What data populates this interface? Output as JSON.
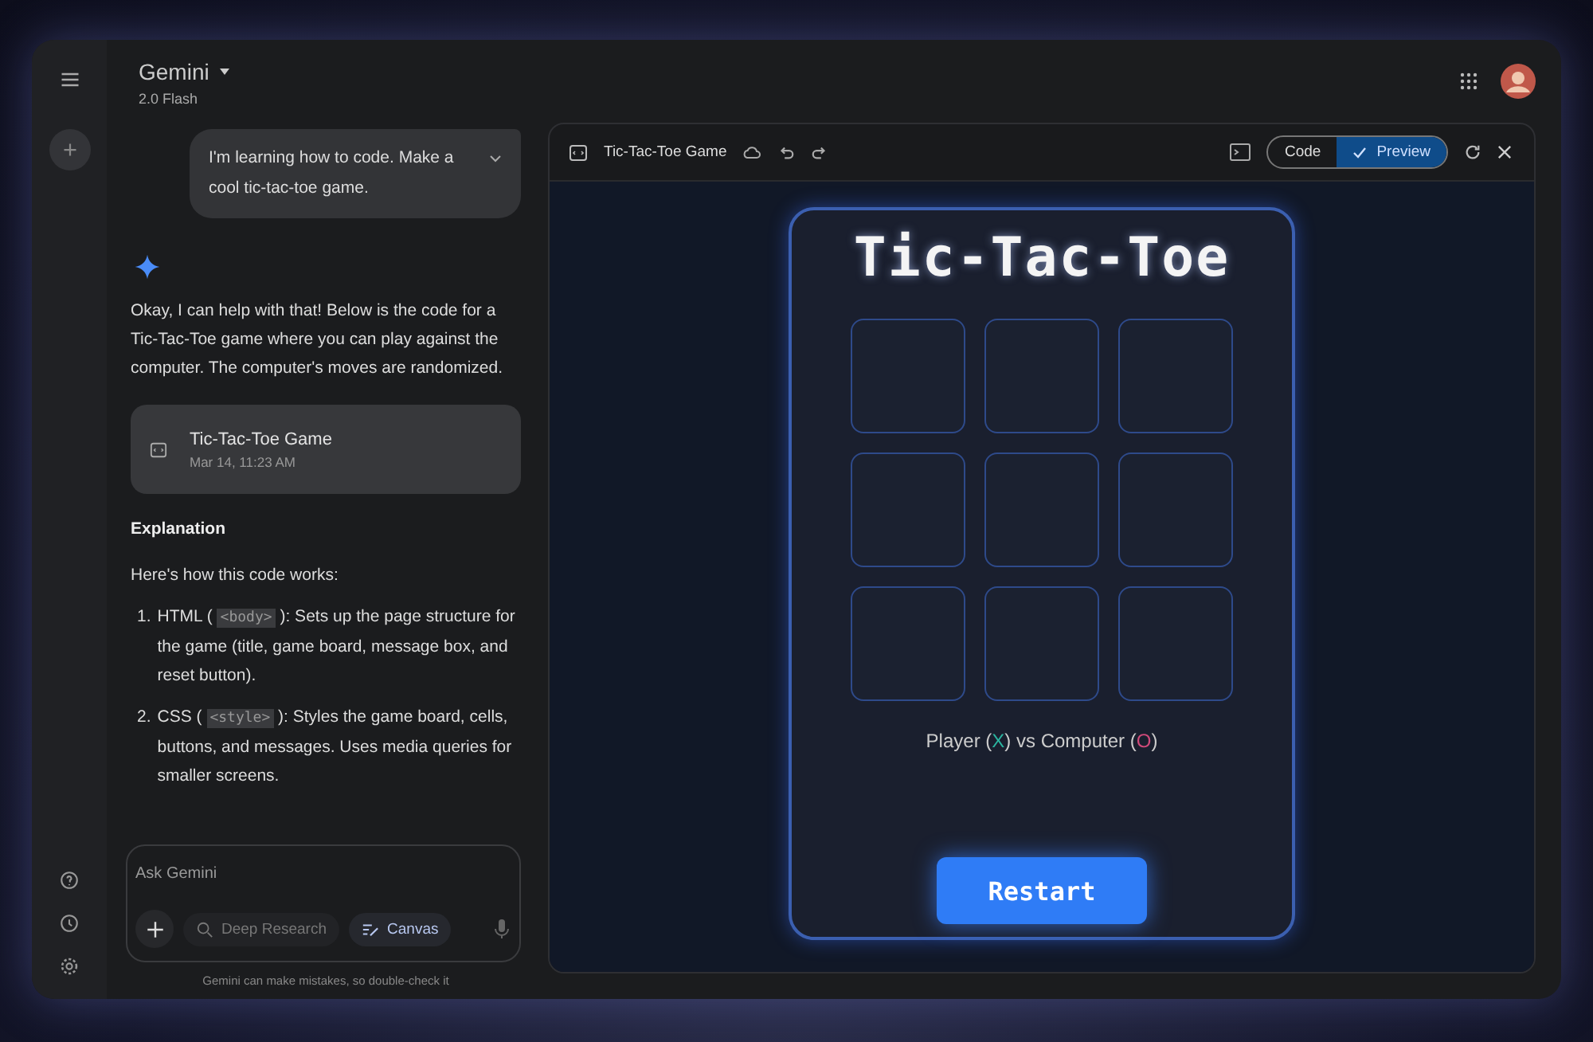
{
  "header": {
    "title": "Gemini",
    "model": "2.0 Flash"
  },
  "user_message": "I'm learning how to code. Make a cool tic-tac-toe game.",
  "reply": {
    "intro": "Okay, I can help with that! Below is the code for a Tic-Tac-Toe game where you can play against the computer. The computer's moves are randomized.",
    "artifact": {
      "title": "Tic-Tac-Toe Game",
      "date": "Mar 14, 11:23 AM"
    },
    "heading": "Explanation",
    "lead": "Here's how this code works:",
    "items": [
      {
        "number": "1.",
        "parts": [
          {
            "kind": "text",
            "text": "HTML ( "
          },
          {
            "kind": "code",
            "text": "<body>"
          },
          {
            "kind": "text",
            "text": " ): Sets up the page structure for the game (title, game board, message box, and reset button)."
          }
        ]
      },
      {
        "number": "2.",
        "parts": [
          {
            "kind": "text",
            "text": "CSS ( "
          },
          {
            "kind": "code",
            "text": "<style>"
          },
          {
            "kind": "text",
            "text": " ): Styles the game board, cells, buttons, and messages. Uses media queries for smaller screens."
          }
        ]
      }
    ]
  },
  "composer": {
    "placeholder": "Ask Gemini",
    "tools": [
      {
        "label": "Deep Research",
        "kind": "research",
        "selected": false
      },
      {
        "label": "Canvas",
        "kind": "canvas",
        "selected": true
      }
    ],
    "disclaimer": "Gemini can make mistakes, so double-check it"
  },
  "canvas": {
    "title": "Tic-Tac-Toe Game",
    "views": [
      {
        "label": "Code",
        "selected": false
      },
      {
        "label": "Preview",
        "selected": true
      }
    ]
  },
  "game": {
    "title": "Tic-Tac-Toe",
    "cells": [
      {
        "kind": "empty"
      },
      {
        "kind": "empty"
      },
      {
        "kind": "empty"
      },
      {
        "kind": "empty"
      },
      {
        "kind": "empty"
      },
      {
        "kind": "empty"
      },
      {
        "kind": "empty"
      },
      {
        "kind": "empty"
      },
      {
        "kind": "empty"
      }
    ],
    "status": [
      {
        "kind": "text",
        "text": "Player ("
      },
      {
        "kind": "x",
        "text": "X"
      },
      {
        "kind": "text",
        "text": ") vs Computer ("
      },
      {
        "kind": "o",
        "text": "O"
      },
      {
        "kind": "text",
        "text": ")"
      }
    ],
    "button": "Restart"
  }
}
